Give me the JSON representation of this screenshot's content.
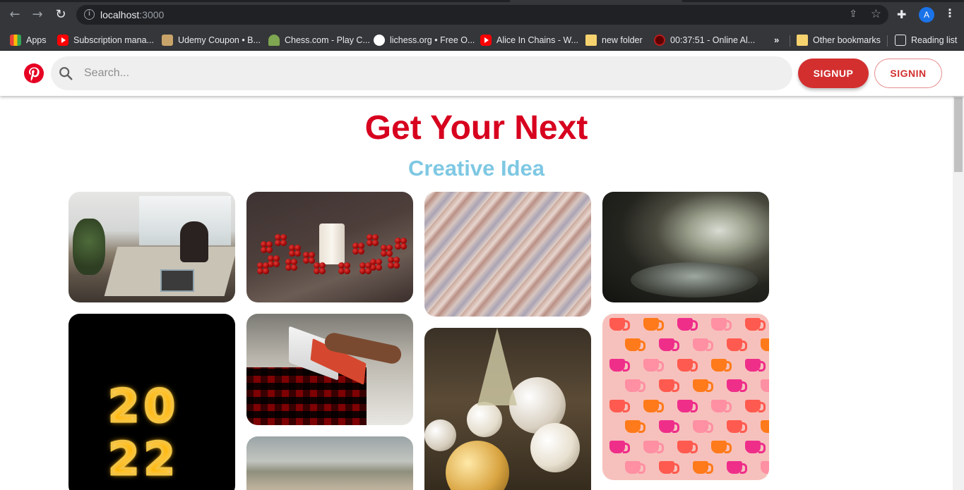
{
  "browser": {
    "url_host": "localhost",
    "url_port": ":3000",
    "profile_initial": "A",
    "bookmarks": [
      {
        "label": "Apps",
        "icon": "apps-grid-icon"
      },
      {
        "label": "Subscription mana...",
        "icon": "youtube-icon"
      },
      {
        "label": "Udemy Coupon • B...",
        "icon": "udemy-icon"
      },
      {
        "label": "Chess.com - Play C...",
        "icon": "chess-pawn-icon"
      },
      {
        "label": "lichess.org • Free O...",
        "icon": "lichess-icon"
      },
      {
        "label": "Alice In Chains - W...",
        "icon": "youtube-icon"
      },
      {
        "label": "new folder",
        "icon": "folder-icon"
      },
      {
        "label": "00:37:51 - Online Al...",
        "icon": "clock-icon"
      }
    ],
    "overflow_label": "»",
    "other_bookmarks": "Other bookmarks",
    "reading_list": "Reading list"
  },
  "header": {
    "search_placeholder": "Search...",
    "signup_label": "SIGNUP",
    "signin_label": "SIGNIN"
  },
  "hero": {
    "title": "Get Your Next",
    "subtitle": "Creative Idea"
  },
  "pins": [
    {
      "subject": "office-meeting"
    },
    {
      "subject": "red-berries-candle"
    },
    {
      "subject": "textured-surface"
    },
    {
      "subject": "cave-landscape"
    },
    {
      "subject": "sparkler-2022",
      "text_line1": "20",
      "text_line2": "22"
    },
    {
      "subject": "laptop-on-blanket"
    },
    {
      "subject": "desert-hills"
    },
    {
      "subject": "christmas-ornaments"
    },
    {
      "subject": "pink-cups-pattern"
    }
  ],
  "colors": {
    "brand_red": "#e60023",
    "title_red": "#d7001e",
    "subtitle_blue": "#7ec8e3",
    "button_red": "#d32f2f"
  }
}
